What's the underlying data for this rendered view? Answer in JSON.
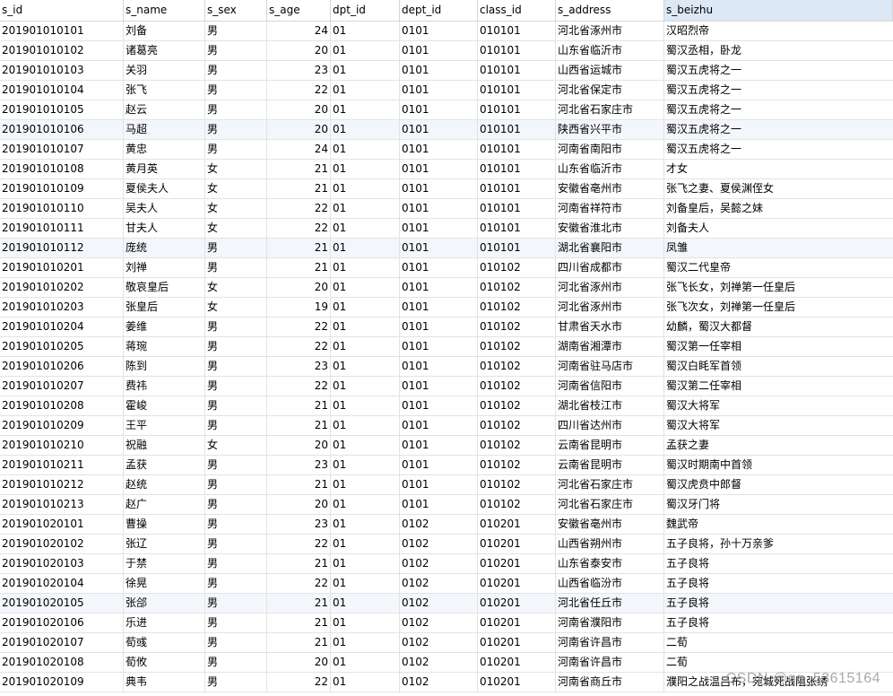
{
  "columns": [
    "s_id",
    "s_name",
    "s_sex",
    "s_age",
    "dpt_id",
    "dept_id",
    "class_id",
    "s_address",
    "s_beizhu"
  ],
  "numeric_columns": [
    3
  ],
  "sorted_column": 8,
  "rows": [
    [
      "201901010101",
      "刘备",
      "男",
      "24",
      "01",
      "0101",
      "010101",
      "河北省涿州市",
      "汉昭烈帝"
    ],
    [
      "201901010102",
      "诸葛亮",
      "男",
      "20",
      "01",
      "0101",
      "010101",
      "山东省临沂市",
      "蜀汉丞相，卧龙"
    ],
    [
      "201901010103",
      "关羽",
      "男",
      "23",
      "01",
      "0101",
      "010101",
      "山西省运城市",
      "蜀汉五虎将之一"
    ],
    [
      "201901010104",
      "张飞",
      "男",
      "22",
      "01",
      "0101",
      "010101",
      "河北省保定市",
      "蜀汉五虎将之一"
    ],
    [
      "201901010105",
      "赵云",
      "男",
      "20",
      "01",
      "0101",
      "010101",
      "河北省石家庄市",
      "蜀汉五虎将之一"
    ],
    [
      "201901010106",
      "马超",
      "男",
      "20",
      "01",
      "0101",
      "010101",
      "陕西省兴平市",
      "蜀汉五虎将之一"
    ],
    [
      "201901010107",
      "黄忠",
      "男",
      "24",
      "01",
      "0101",
      "010101",
      "河南省南阳市",
      "蜀汉五虎将之一"
    ],
    [
      "201901010108",
      "黄月英",
      "女",
      "21",
      "01",
      "0101",
      "010101",
      "山东省临沂市",
      "才女"
    ],
    [
      "201901010109",
      "夏侯夫人",
      "女",
      "21",
      "01",
      "0101",
      "010101",
      "安徽省亳州市",
      "张飞之妻、夏侯渊侄女"
    ],
    [
      "201901010110",
      "吴夫人",
      "女",
      "22",
      "01",
      "0101",
      "010101",
      "河南省祥符市",
      "刘备皇后，吴懿之妹"
    ],
    [
      "201901010111",
      "甘夫人",
      "女",
      "22",
      "01",
      "0101",
      "010101",
      "安徽省淮北市",
      "刘备夫人"
    ],
    [
      "201901010112",
      "庞统",
      "男",
      "21",
      "01",
      "0101",
      "010101",
      "湖北省襄阳市",
      "凤雏"
    ],
    [
      "201901010201",
      "刘禅",
      "男",
      "21",
      "01",
      "0101",
      "010102",
      "四川省成都市",
      "蜀汉二代皇帝"
    ],
    [
      "201901010202",
      "敬哀皇后",
      "女",
      "20",
      "01",
      "0101",
      "010102",
      "河北省涿州市",
      "张飞长女，刘禅第一任皇后"
    ],
    [
      "201901010203",
      "张皇后",
      "女",
      "19",
      "01",
      "0101",
      "010102",
      "河北省涿州市",
      "张飞次女，刘禅第一任皇后"
    ],
    [
      "201901010204",
      "姜维",
      "男",
      "22",
      "01",
      "0101",
      "010102",
      "甘肃省天水市",
      "幼麟，蜀汉大都督"
    ],
    [
      "201901010205",
      "蒋琬",
      "男",
      "22",
      "01",
      "0101",
      "010102",
      "湖南省湘潭市",
      "蜀汉第一任宰相"
    ],
    [
      "201901010206",
      "陈到",
      "男",
      "23",
      "01",
      "0101",
      "010102",
      "河南省驻马店市",
      "蜀汉白眊军首领"
    ],
    [
      "201901010207",
      "费祎",
      "男",
      "22",
      "01",
      "0101",
      "010102",
      "河南省信阳市",
      "蜀汉第二任宰相"
    ],
    [
      "201901010208",
      "霍峻",
      "男",
      "21",
      "01",
      "0101",
      "010102",
      "湖北省枝江市",
      "蜀汉大将军"
    ],
    [
      "201901010209",
      "王平",
      "男",
      "21",
      "01",
      "0101",
      "010102",
      "四川省达州市",
      "蜀汉大将军"
    ],
    [
      "201901010210",
      "祝融",
      "女",
      "20",
      "01",
      "0101",
      "010102",
      "云南省昆明市",
      "孟获之妻"
    ],
    [
      "201901010211",
      "孟获",
      "男",
      "23",
      "01",
      "0101",
      "010102",
      "云南省昆明市",
      "蜀汉时期南中首领"
    ],
    [
      "201901010212",
      "赵统",
      "男",
      "21",
      "01",
      "0101",
      "010102",
      "河北省石家庄市",
      "蜀汉虎贲中郎督"
    ],
    [
      "201901010213",
      "赵广",
      "男",
      "20",
      "01",
      "0101",
      "010102",
      "河北省石家庄市",
      "蜀汉牙门将"
    ],
    [
      "201901020101",
      "曹操",
      "男",
      "23",
      "01",
      "0102",
      "010201",
      "安徽省亳州市",
      "魏武帝"
    ],
    [
      "201901020102",
      "张辽",
      "男",
      "22",
      "01",
      "0102",
      "010201",
      "山西省朔州市",
      "五子良将，孙十万亲爹"
    ],
    [
      "201901020103",
      "于禁",
      "男",
      "21",
      "01",
      "0102",
      "010201",
      "山东省泰安市",
      "五子良将"
    ],
    [
      "201901020104",
      "徐晃",
      "男",
      "22",
      "01",
      "0102",
      "010201",
      "山西省临汾市",
      "五子良将"
    ],
    [
      "201901020105",
      "张郃",
      "男",
      "21",
      "01",
      "0102",
      "010201",
      "河北省任丘市",
      "五子良将"
    ],
    [
      "201901020106",
      "乐进",
      "男",
      "21",
      "01",
      "0102",
      "010201",
      "河南省濮阳市",
      "五子良将"
    ],
    [
      "201901020107",
      "荀彧",
      "男",
      "21",
      "01",
      "0102",
      "010201",
      "河南省许昌市",
      "二荀"
    ],
    [
      "201901020108",
      "荀攸",
      "男",
      "20",
      "01",
      "0102",
      "010201",
      "河南省许昌市",
      "二荀"
    ],
    [
      "201901020109",
      "典韦",
      "男",
      "22",
      "01",
      "0102",
      "010201",
      "河南省商丘市",
      "濮阳之战温吕布，宛城死战阻张绣"
    ]
  ],
  "alt_rows": [
    5,
    11,
    29
  ],
  "watermark": "CSDN @qq_53615164",
  "colors": {
    "header_sorted_bg": "#dce8f6",
    "alt_row_bg": "#f3f7fc",
    "grid_line": "#e3e3e3"
  }
}
